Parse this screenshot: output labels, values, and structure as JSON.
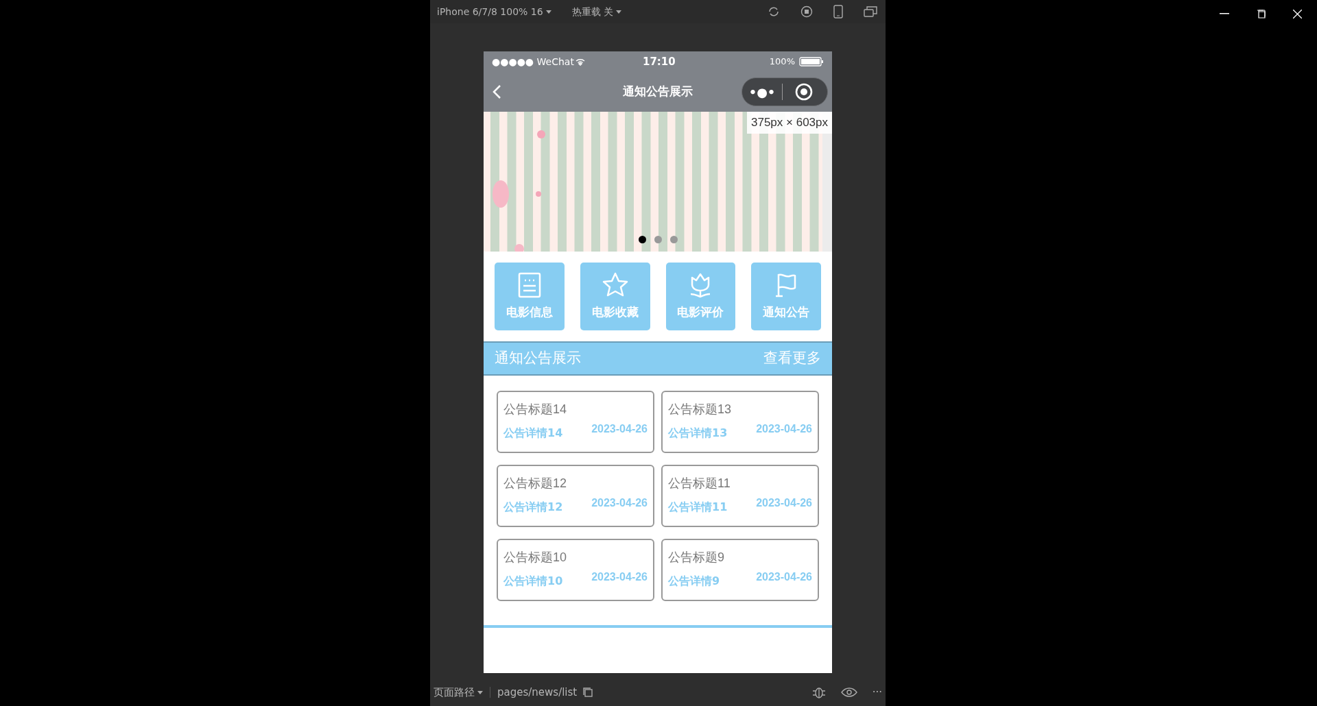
{
  "toolbar": {
    "device": "iPhone 6/7/8 100% 16",
    "hot_reload": "热重载 关"
  },
  "status_bar": {
    "signal": "●●●●● WeChat",
    "time": "17:10",
    "battery": "100%"
  },
  "nav_bar": {
    "title": "通知公告展示",
    "capsule_dots": "•●•"
  },
  "banner": {
    "size_tip": "375px × 603px",
    "dots": [
      {
        "selected": true
      },
      {
        "selected": false
      },
      {
        "selected": false
      }
    ]
  },
  "menu": [
    {
      "kind": "list",
      "label": "电影信息"
    },
    {
      "kind": "star",
      "label": "电影收藏"
    },
    {
      "kind": "tulip",
      "label": "电影评价"
    },
    {
      "kind": "flag",
      "label": "通知公告"
    }
  ],
  "section": {
    "title": "通知公告展示",
    "more": "查看更多"
  },
  "notices": [
    {
      "title": "公告标题14",
      "detail": "公告详情14",
      "date": "2023-04-26"
    },
    {
      "title": "公告标题13",
      "detail": "公告详情13",
      "date": "2023-04-26"
    },
    {
      "title": "公告标题12",
      "detail": "公告详情12",
      "date": "2023-04-26"
    },
    {
      "title": "公告标题11",
      "detail": "公告详情11",
      "date": "2023-04-26"
    },
    {
      "title": "公告标题10",
      "detail": "公告详情10",
      "date": "2023-04-26"
    },
    {
      "title": "公告标题9",
      "detail": "公告详情9",
      "date": "2023-04-26"
    }
  ],
  "footer": {
    "path_label": "页面路径",
    "path": "pages/news/list",
    "more": "···"
  }
}
